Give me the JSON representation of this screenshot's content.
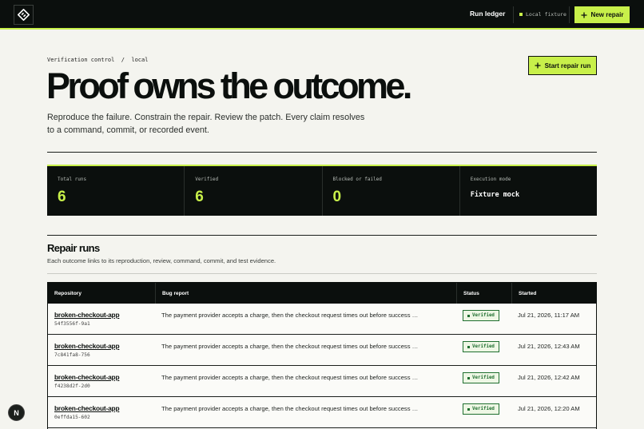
{
  "header": {
    "run_ledger": "Run ledger",
    "fixture_label": "Local fixture",
    "new_repair": "New repair",
    "accent": "#c8f04a"
  },
  "hero": {
    "breadcrumb": "Verification control  /  local",
    "headline": "Proof owns the outcome.",
    "lede": "Reproduce the failure. Constrain the repair. Review the patch. Every claim resolves to a command, commit, or recorded event.",
    "start_button": "Start repair run"
  },
  "stats": [
    {
      "label": "Total runs",
      "value": "6"
    },
    {
      "label": "Verified",
      "value": "6"
    },
    {
      "label": "Blocked or failed",
      "value": "0"
    },
    {
      "label": "Execution mode",
      "value": "Fixture mock"
    }
  ],
  "section": {
    "title": "Repair runs",
    "subtitle": "Each outcome links to its reproduction, review, command, commit, and test evidence."
  },
  "table": {
    "columns": [
      "Repository",
      "Bug report",
      "Status",
      "Started"
    ],
    "rows": [
      {
        "repo": "broken-checkout-app",
        "sha": "54f3556f-9a1",
        "bug": "The payment provider accepts a charge, then the checkout request times out before success is recorded.",
        "status": "Verified",
        "started": "Jul 21, 2026, 11:17 AM"
      },
      {
        "repo": "broken-checkout-app",
        "sha": "7c841fa8-756",
        "bug": "The payment provider accepts a charge, then the checkout request times out before success is recorded.",
        "status": "Verified",
        "started": "Jul 21, 2026, 12:43 AM"
      },
      {
        "repo": "broken-checkout-app",
        "sha": "f4238d2f-2d0",
        "bug": "The payment provider accepts a charge, then the checkout request times out before success is recorded.",
        "status": "Verified",
        "started": "Jul 21, 2026, 12:42 AM"
      },
      {
        "repo": "broken-checkout-app",
        "sha": "0effda15-602",
        "bug": "The payment provider accepts a charge, then the checkout request times out before success is recorded.",
        "status": "Verified",
        "started": "Jul 21, 2026, 12:20 AM"
      }
    ]
  },
  "fab": {
    "label": "N"
  }
}
